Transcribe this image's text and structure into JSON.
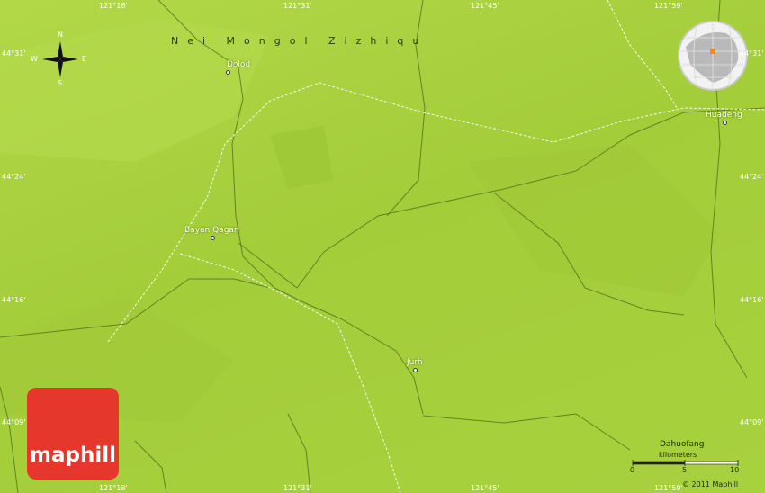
{
  "map": {
    "region_label": "Nei Mongol Zizhiqu",
    "copyright": "© 2011 Maphill",
    "brand": "maphill",
    "compass": {
      "n": "N",
      "s": "S",
      "e": "E",
      "w": "W"
    },
    "scale": {
      "unit": "kilometers",
      "ticks": [
        "0",
        "5",
        "10"
      ]
    },
    "coords_top": [
      "121°18'",
      "121°31'",
      "121°45'",
      "121°59'"
    ],
    "coords_bottom": [
      "121°18'",
      "121°31'",
      "121°45'",
      "121°59'"
    ],
    "coords_left": [
      "44°31'",
      "44°24'",
      "44°16'",
      "44°09'"
    ],
    "coords_right": [
      "44°31'",
      "44°24'",
      "44°16'",
      "44°09'"
    ],
    "places": [
      "Dolod",
      "Huadeng",
      "Bayan Qagan",
      "Jurh",
      "Dahuofang"
    ],
    "colors": {
      "land": "#a8d03c",
      "logo": "#e5372b",
      "marker": "#f08a2c"
    }
  }
}
